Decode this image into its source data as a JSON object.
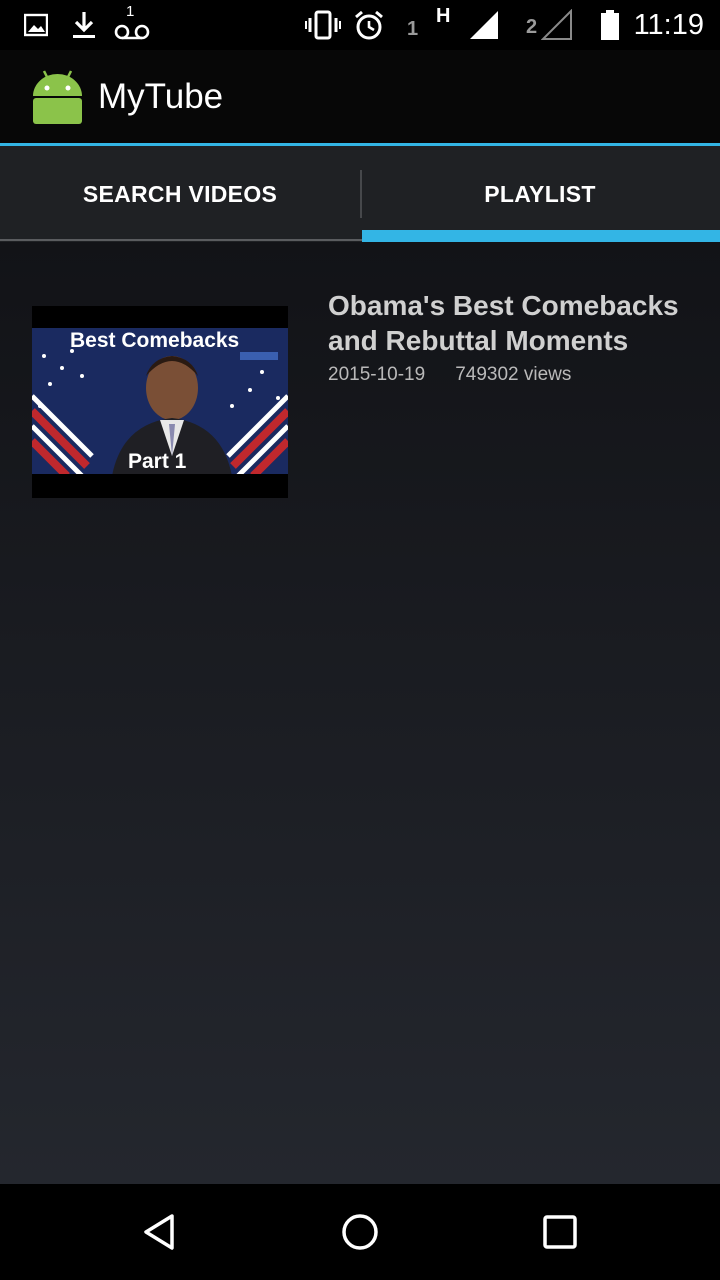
{
  "status_bar": {
    "time": "11:19",
    "voicemail_count": "1",
    "sim1_label": "1",
    "network_type": "H",
    "sim2_label": "2",
    "icons": [
      "image-icon",
      "download-icon",
      "voicemail-icon",
      "vibrate-icon",
      "alarm-icon",
      "signal-icon",
      "signal-empty-icon",
      "battery-icon"
    ]
  },
  "app_bar": {
    "title": "MyTube",
    "logo": "android-icon",
    "accent_color": "#33b5e5"
  },
  "tabs": [
    {
      "label": "SEARCH VIDEOS",
      "selected": false
    },
    {
      "label": "PLAYLIST",
      "selected": true
    }
  ],
  "videos": [
    {
      "title": "Obama's Best Comebacks and Rebuttal Moments",
      "date": "2015-10-19",
      "views": "749302 views",
      "thumbnail": {
        "headline": "Best Comebacks",
        "caption": "Part 1"
      }
    }
  ],
  "nav_bar": {
    "icons": [
      "back-icon",
      "home-icon",
      "recents-icon"
    ]
  }
}
